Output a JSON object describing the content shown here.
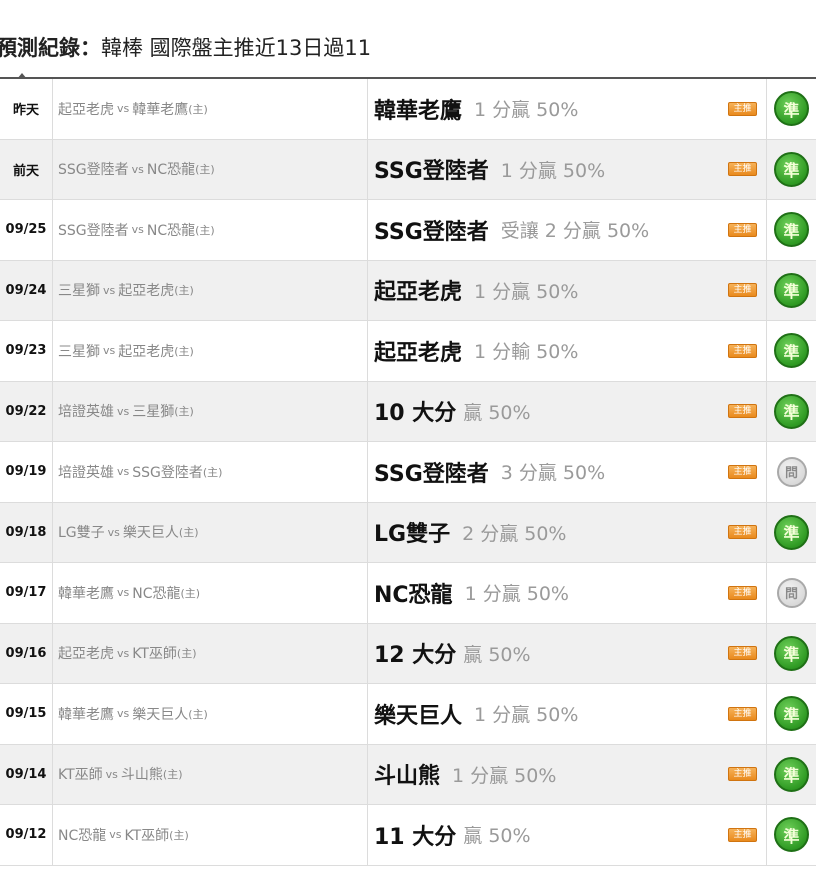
{
  "header": {
    "title_bold": "預測紀錄：",
    "title_rest": "韓棒 國際盤主推近13日過11"
  },
  "badge_label": "主推",
  "rows": [
    {
      "date": "昨天",
      "away": "起亞老虎",
      "vs": "vs",
      "home": "韓華老鷹",
      "host_mark": "(主)",
      "pick": "韓華老鷹",
      "detail": "1 分贏 50%",
      "result": "準",
      "result_type": "hit"
    },
    {
      "date": "前天",
      "away": "SSG登陸者",
      "vs": "vs",
      "home": "NC恐龍",
      "host_mark": "(主)",
      "pick": "SSG登陸者",
      "detail": "1 分贏 50%",
      "result": "準",
      "result_type": "hit"
    },
    {
      "date": "09/25",
      "away": "SSG登陸者",
      "vs": "vs",
      "home": "NC恐龍",
      "host_mark": "(主)",
      "pick": "SSG登陸者",
      "detail": "受讓 2 分贏 50%",
      "result": "準",
      "result_type": "hit"
    },
    {
      "date": "09/24",
      "away": "三星獅",
      "vs": "vs",
      "home": "起亞老虎",
      "host_mark": "(主)",
      "pick": "起亞老虎",
      "detail": "1 分贏 50%",
      "result": "準",
      "result_type": "hit"
    },
    {
      "date": "09/23",
      "away": "三星獅",
      "vs": "vs",
      "home": "起亞老虎",
      "host_mark": "(主)",
      "pick": "起亞老虎",
      "detail": "1 分輸 50%",
      "result": "準",
      "result_type": "hit"
    },
    {
      "date": "09/22",
      "away": "培證英雄",
      "vs": "vs",
      "home": "三星獅",
      "host_mark": "(主)",
      "pick": "10 大分",
      "detail": "贏 50%",
      "result": "準",
      "result_type": "hit"
    },
    {
      "date": "09/19",
      "away": "培證英雄",
      "vs": "vs",
      "home": "SSG登陸者",
      "host_mark": "(主)",
      "pick": "SSG登陸者",
      "detail": "3 分贏 50%",
      "result": "問",
      "result_type": "miss"
    },
    {
      "date": "09/18",
      "away": "LG雙子",
      "vs": "vs",
      "home": "樂天巨人",
      "host_mark": "(主)",
      "pick": "LG雙子",
      "detail": "2 分贏 50%",
      "result": "準",
      "result_type": "hit"
    },
    {
      "date": "09/17",
      "away": "韓華老鷹",
      "vs": "vs",
      "home": "NC恐龍",
      "host_mark": "(主)",
      "pick": "NC恐龍",
      "detail": "1 分贏 50%",
      "result": "問",
      "result_type": "miss"
    },
    {
      "date": "09/16",
      "away": "起亞老虎",
      "vs": "vs",
      "home": "KT巫師",
      "host_mark": "(主)",
      "pick": "12 大分",
      "detail": "贏 50%",
      "result": "準",
      "result_type": "hit"
    },
    {
      "date": "09/15",
      "away": "韓華老鷹",
      "vs": "vs",
      "home": "樂天巨人",
      "host_mark": "(主)",
      "pick": "樂天巨人",
      "detail": "1 分贏 50%",
      "result": "準",
      "result_type": "hit"
    },
    {
      "date": "09/14",
      "away": "KT巫師",
      "vs": "vs",
      "home": "斗山熊",
      "host_mark": "(主)",
      "pick": "斗山熊",
      "detail": "1 分贏 50%",
      "result": "準",
      "result_type": "hit"
    },
    {
      "date": "09/12",
      "away": "NC恐龍",
      "vs": "vs",
      "home": "KT巫師",
      "host_mark": "(主)",
      "pick": "11 大分",
      "detail": "贏 50%",
      "result": "準",
      "result_type": "hit"
    }
  ]
}
